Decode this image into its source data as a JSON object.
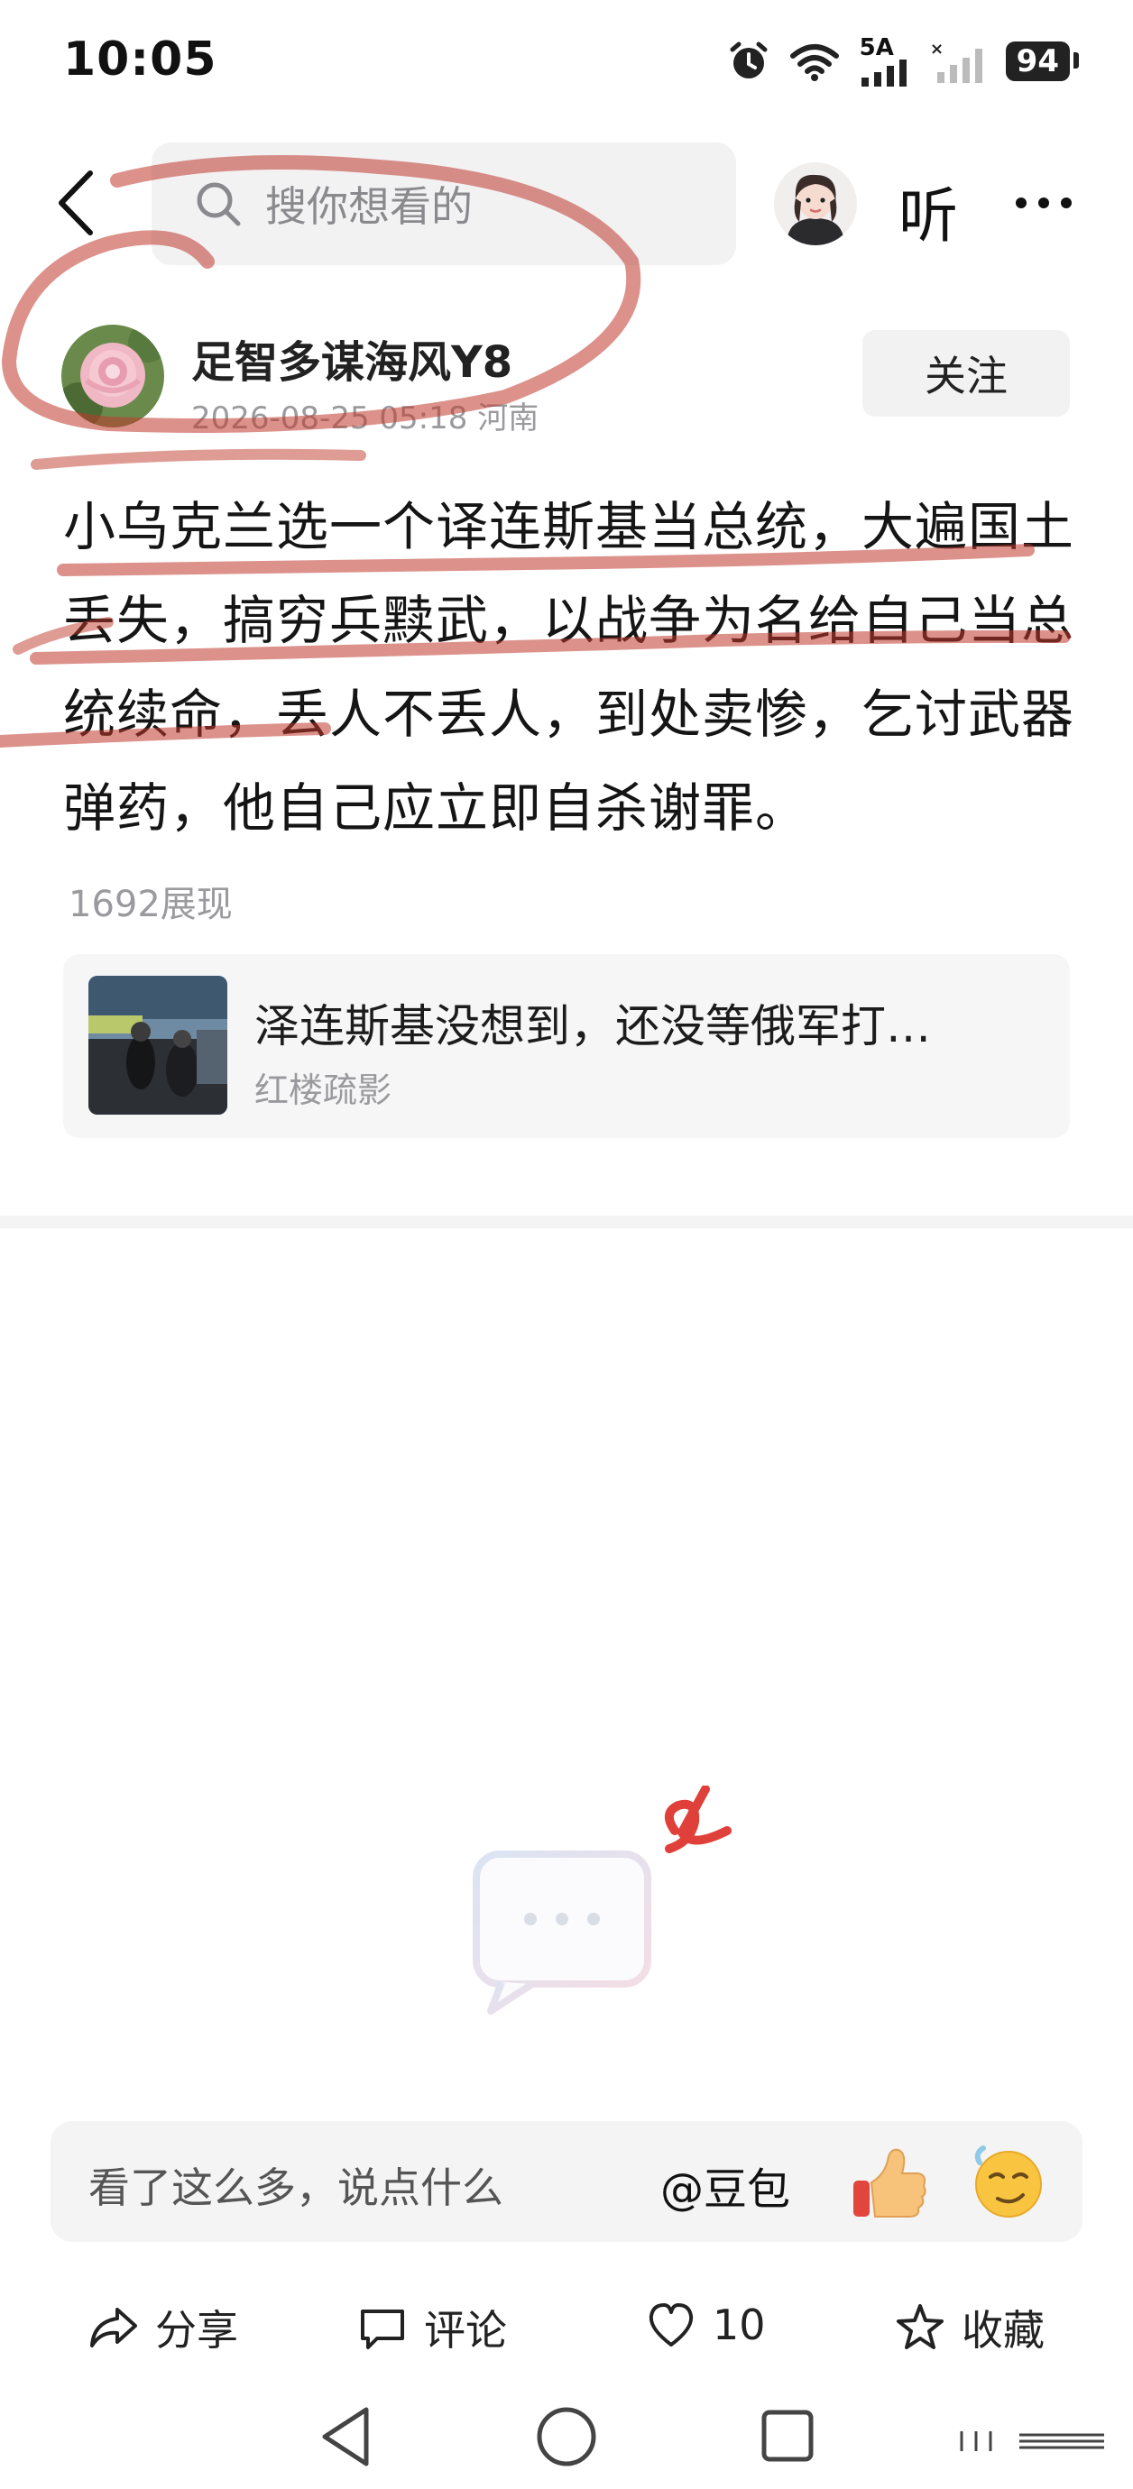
{
  "status_bar": {
    "time": "10:05",
    "network": "5A",
    "battery": "94",
    "icons": [
      "alarm-icon",
      "wifi-icon",
      "signal-icon",
      "signal-weak-icon",
      "battery-icon"
    ]
  },
  "top_bar": {
    "search_placeholder": "搜你想看的",
    "listen_label": "听"
  },
  "author": {
    "name": "足智多谋海风Y8",
    "meta": "2026-08-25 05:18 河南",
    "follow_label": "关注"
  },
  "post": {
    "text": "小乌克兰选一个译连斯基当总统，大遍国土丢失，搞穷兵黩武，以战争为名给自己当总统续命，丢人不丢人，到处卖惨，乞讨武器弹药，他自己应立即自杀谢罪。",
    "views": "1692展现"
  },
  "related": {
    "title": "泽连斯基没想到，还没等俄军打…",
    "source": "红楼疏影"
  },
  "comment_bar": {
    "placeholder": "看了这么多，说点什么",
    "at_label": "@豆包"
  },
  "actions": {
    "share": "分享",
    "comment": "评论",
    "like_count": "10",
    "favorite": "收藏"
  },
  "colors": {
    "marker": "#c0392b",
    "background": "#ffffff",
    "search_bg": "#f2f2f3"
  }
}
